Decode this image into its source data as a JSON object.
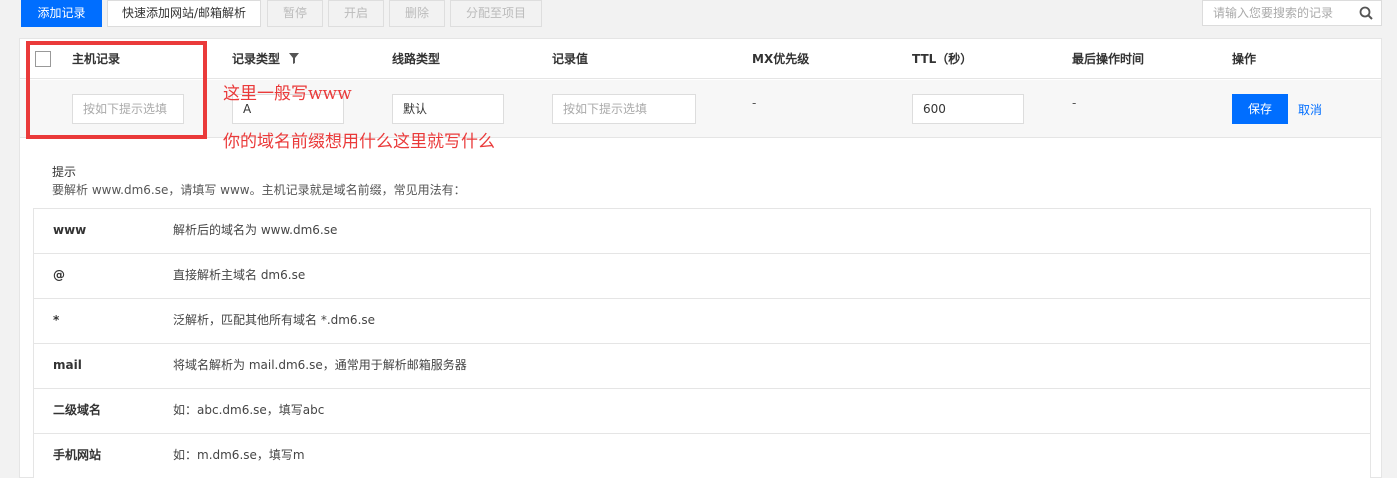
{
  "toolbar": {
    "add_record": "添加记录",
    "quick_add": "快速添加网站/邮箱解析",
    "pause": "暂停",
    "enable": "开启",
    "delete": "删除",
    "assign_project": "分配至项目"
  },
  "search": {
    "placeholder": "请输入您要搜索的记录",
    "icon": "search-icon"
  },
  "table": {
    "headers": {
      "host": "主机记录",
      "type": "记录类型",
      "line": "线路类型",
      "value": "记录值",
      "mx": "MX优先级",
      "ttl": "TTL（秒）",
      "last_op": "最后操作时间",
      "actions": "操作"
    },
    "edit_row": {
      "host_placeholder": "按如下提示选填",
      "type_value": "A",
      "line_value": "默认",
      "value_placeholder": "按如下提示选填",
      "mx": "-",
      "ttl": "600",
      "last_op": "-",
      "save": "保存",
      "cancel": "取消"
    }
  },
  "annotations": {
    "line1": "这里一般写www",
    "line2": "你的域名前缀想用什么这里就写什么",
    "color": "#ea3a3a"
  },
  "tips": {
    "title": "提示",
    "description": "要解析 www.dm6.se，请填写 www。主机记录就是域名前缀，常见用法有：",
    "rows": [
      {
        "key": "www",
        "desc": "解析后的域名为 www.dm6.se"
      },
      {
        "key": "@",
        "desc": "直接解析主域名 dm6.se"
      },
      {
        "key": "*",
        "desc": "泛解析，匹配其他所有域名 *.dm6.se"
      },
      {
        "key": "mail",
        "desc": "将域名解析为 mail.dm6.se，通常用于解析邮箱服务器"
      },
      {
        "key": "二级域名",
        "desc": "如：abc.dm6.se，填写abc"
      },
      {
        "key": "手机网站",
        "desc": "如：m.dm6.se，填写m"
      }
    ]
  },
  "colors": {
    "primary": "#006eff",
    "annotation": "#ea3a3a"
  }
}
